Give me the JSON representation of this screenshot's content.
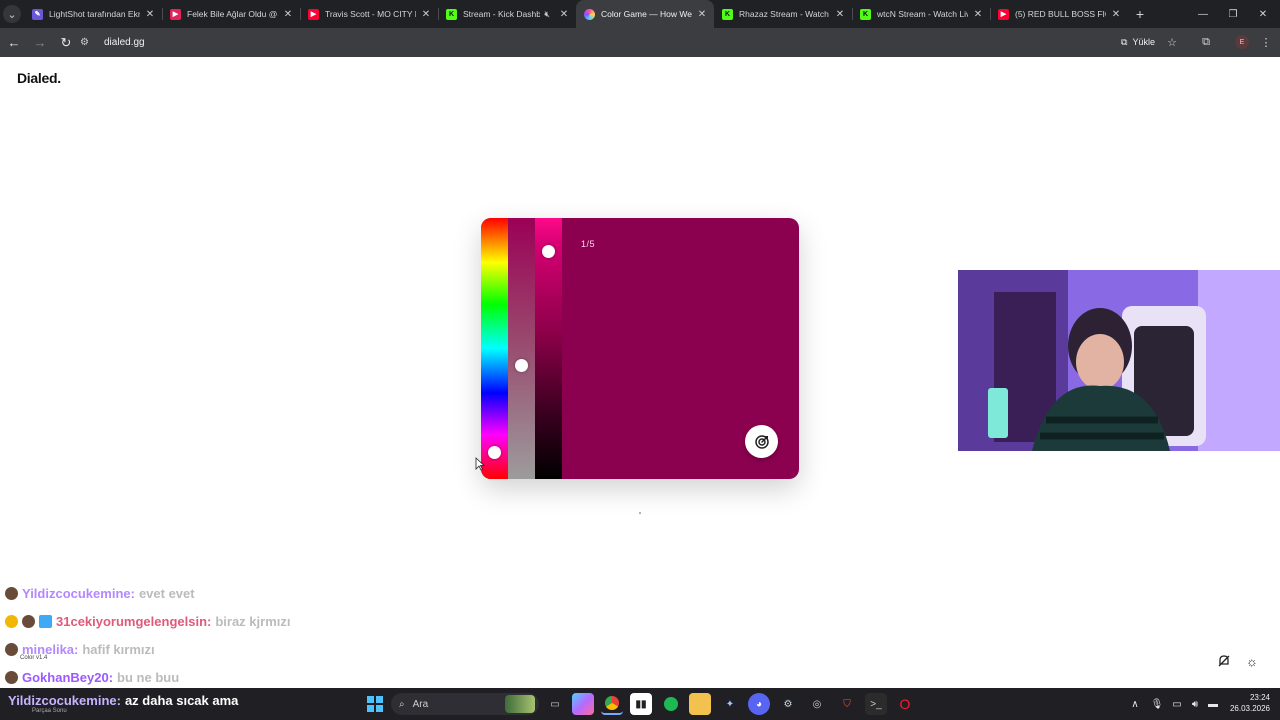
{
  "browser": {
    "tabs": [
      {
        "title": "LightShot tarafından Ekra",
        "favicon_color": "#6b57d6",
        "favicon_glyph": "✎",
        "active": false
      },
      {
        "title": "Felek Bile Ağlar Oldu @Sı",
        "favicon_color": "#e0245e",
        "favicon_glyph": "▶",
        "active": false
      },
      {
        "title": "Travis Scott - MO CITY FLI",
        "favicon_color": "#ff0033",
        "favicon_glyph": "▶",
        "active": false
      },
      {
        "title": "Stream - Kick Dashbo",
        "favicon_color": "#53fc18",
        "favicon_glyph": "K",
        "active": false,
        "muted": true
      },
      {
        "title": "Color Game — How Well",
        "favicon_color": "#ff4fa0",
        "favicon_glyph": "●",
        "active": true
      },
      {
        "title": "Rhazaz Stream - Watch Li",
        "favicon_color": "#53fc18",
        "favicon_glyph": "K",
        "active": false
      },
      {
        "title": "wtcN Stream - Watch Live",
        "favicon_color": "#53fc18",
        "favicon_glyph": "K",
        "active": false
      },
      {
        "title": "(5) RED BULL BOSS FIGHT",
        "favicon_color": "#ff0033",
        "favicon_glyph": "▶",
        "active": false
      }
    ],
    "url": "dialed.gg",
    "install_label": "Yükle",
    "profile_initial": "E"
  },
  "page": {
    "logo": "Dialed.",
    "round_counter": "1/5",
    "color": "#8c0050",
    "hue_level": 0.92,
    "saturation_level": 0.43,
    "lightness_level": 0.89
  },
  "chat": {
    "messages": [
      {
        "user": "Yildizcocukemine:",
        "text": "evet evet",
        "user_color": "#b388ff",
        "badge_color": "#6a4b3a"
      },
      {
        "user": "31cekiyorumgelengelsin:",
        "text": "biraz kjrmızı",
        "user_color": "#e05a7a",
        "badge_color": "#f2b705"
      },
      {
        "user": "minelika:",
        "text": "hafif kırmızı",
        "user_color": "#b388ff",
        "badge_color": "#6a4b3a"
      },
      {
        "user": "GokhanBey20:",
        "text": "bu ne buu",
        "user_color": "#9b59ff",
        "badge_color": "#6a4b3a"
      }
    ],
    "sub_label": "Color v1.4"
  },
  "now_playing": {
    "user": "Yildizcocukemine:",
    "text": "az daha sıcak ama",
    "sub_label": "Parçaa Sonu"
  },
  "taskbar": {
    "search_placeholder": "Ara",
    "time": "23:24",
    "date": "26.03.2026"
  }
}
